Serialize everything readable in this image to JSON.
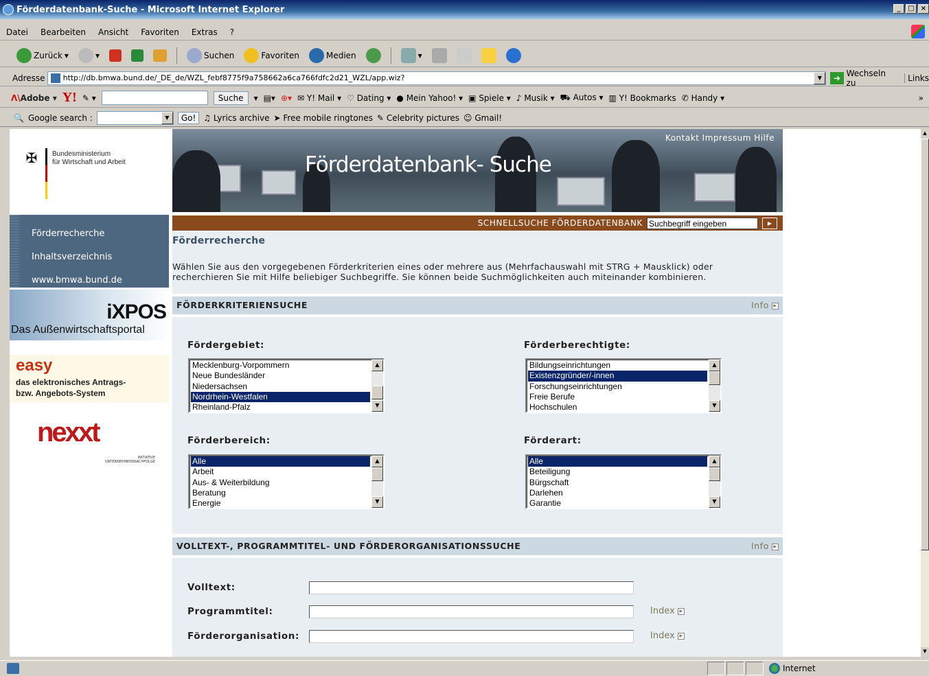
{
  "window": {
    "title": "Förderdatenbank-Suche - Microsoft Internet Explorer",
    "controls": [
      "_",
      "□",
      "×"
    ]
  },
  "menu": [
    "Datei",
    "Bearbeiten",
    "Ansicht",
    "Favoriten",
    "Extras",
    "?"
  ],
  "toolbar": {
    "back": "Zurück",
    "search": "Suchen",
    "favorites": "Favoriten",
    "media": "Medien"
  },
  "address": {
    "label": "Adresse",
    "url": "http://db.bmwa.bund.de/_DE_de/WZL_febf8775f9a758662a6ca766fdfc2d21_WZL/app.wiz?",
    "go": "Wechseln zu",
    "links": "Links"
  },
  "yahoo": {
    "adobe": "Adobe",
    "search_btn": "Suche",
    "items": [
      "Y! Mail",
      "Dating",
      "Mein Yahoo!",
      "Spiele",
      "Musik",
      "Autos",
      "Y! Bookmarks",
      "Handy"
    ],
    "more": "»"
  },
  "google": {
    "label": "Google search :",
    "go": "Go!",
    "items": [
      "Lyrics archive",
      "Free mobile ringtones",
      "Celebrity pictures",
      "Gmail!"
    ]
  },
  "sidebar": {
    "ministry_line1": "Bundesministerium",
    "ministry_line2": "für Wirtschaft und Arbeit",
    "nav": [
      "Förderrecherche",
      "Inhaltsverzeichnis",
      "www.bmwa.bund.de"
    ],
    "ixpos_title": "iXPOS",
    "ixpos_sub": "Das Außenwirtschaftsportal",
    "easy_title": "easy",
    "easy_line1": "das elektronisches Antrags-",
    "easy_line2": "bzw. Angebots-System",
    "nexxt": "nexxt",
    "nexxt_sub1": "INITIATIVE",
    "nexxt_sub2": "UNTERNEHMENSNACHFOLGE"
  },
  "banner": {
    "links": "Kontakt  Impressum  Hilfe",
    "title": "Förderdatenbank- Suche"
  },
  "quicksearch": {
    "label": "SCHNELLSUCHE FÖRDERDATENBANK",
    "placeholder": "Suchbegriff eingeben"
  },
  "main": {
    "heading": "Förderrecherche",
    "intro": "Wählen Sie aus den vorgegebenen Förderkriterien eines oder mehrere aus (Mehrfachauswahl mit STRG + Mausklick) oder recherchieren Sie mit Hilfe beliebiger Suchbegriffe. Sie können beide Suchmöglichkeiten auch miteinander kombinieren.",
    "section1": {
      "title": "FÖRDERKRITERIENSUCHE",
      "info": "Info"
    },
    "section2": {
      "title": "VOLLTEXT-, PROGRAMMTITEL- UND FÖRDERORGANISATIONSSUCHE",
      "info": "Info"
    },
    "foerdergebiet": {
      "label": "Fördergebiet:",
      "options": [
        "Mecklenburg-Vorpommern",
        "Neue Bundesländer",
        "Niedersachsen",
        "Nordrhein-Westfalen",
        "Rheinland-Pfalz"
      ],
      "selected": 3
    },
    "foerderberechtigte": {
      "label": "Förderberechtigte:",
      "options": [
        "Bildungseinrichtungen",
        "Existenzgründer/-innen",
        "Forschungseinrichtungen",
        "Freie Berufe",
        "Hochschulen"
      ],
      "selected": 1
    },
    "foerderbereich": {
      "label": "Förderbereich:",
      "options": [
        "Alle",
        "Arbeit",
        "Aus- & Weiterbildung",
        "Beratung",
        "Energie"
      ],
      "selected": 0
    },
    "foerderart": {
      "label": "Förderart:",
      "options": [
        "Alle",
        "Beteiligung",
        "Bürgschaft",
        "Darlehen",
        "Garantie"
      ],
      "selected": 0
    },
    "volltext_label": "Volltext:",
    "programmtitel_label": "Programmtitel:",
    "organisation_label": "Förderorganisation:",
    "index": "Index"
  },
  "status": {
    "zone": "Internet"
  }
}
